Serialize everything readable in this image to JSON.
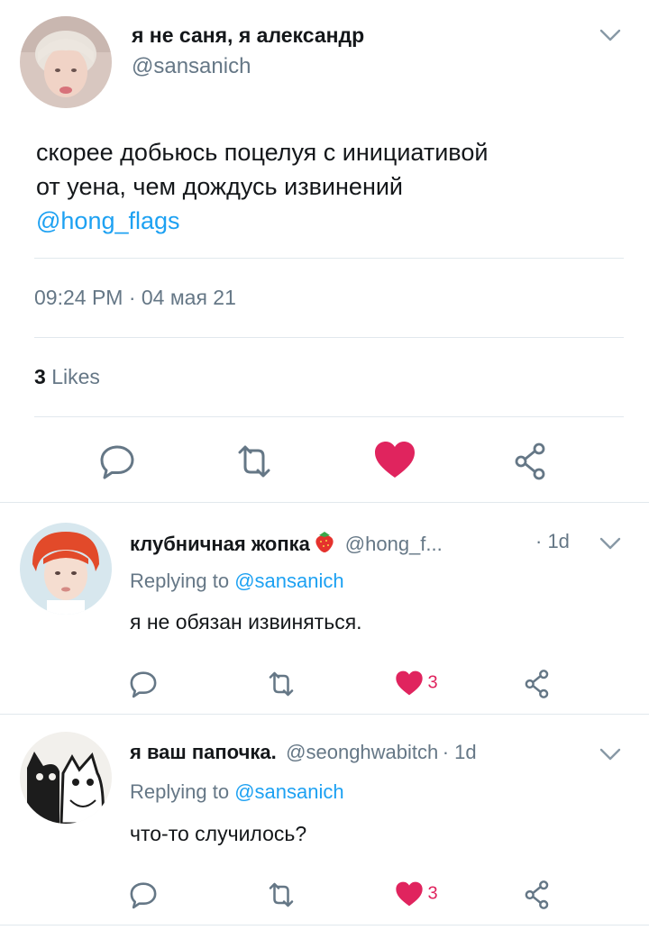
{
  "main_tweet": {
    "display_name": "я не саня, я александр",
    "handle": "@sansanich",
    "text_line1": "скорее добьюсь поцелуя с инициативой",
    "text_line2": "от уена, чем дождусь извинений",
    "mention": "@hong_flags",
    "timestamp": "09:24 PM · 04 мая 21",
    "likes_count": "3",
    "likes_label": "Likes"
  },
  "replies": [
    {
      "display_name": "клубничная жопка",
      "handle": "@hong_f...",
      "age": "· 1d",
      "replying_prefix": "Replying to",
      "replying_to": "@sansanich",
      "text": "я не обязан извиняться.",
      "like_count": "3"
    },
    {
      "display_name": "я ваш папочка.",
      "handle": "@seonghwabitch",
      "age": "· 1d",
      "replying_prefix": "Replying to",
      "replying_to": "@sansanich",
      "text": "что-то случилось?",
      "like_count": "3"
    }
  ],
  "colors": {
    "accent": "#1da1f2",
    "like": "#e0245e",
    "secondary_text": "#657786",
    "divider": "#e1e8ed"
  },
  "icons": [
    "chevron-down-icon",
    "reply-icon",
    "retweet-icon",
    "heart-icon",
    "share-icon",
    "strawberry-icon"
  ]
}
